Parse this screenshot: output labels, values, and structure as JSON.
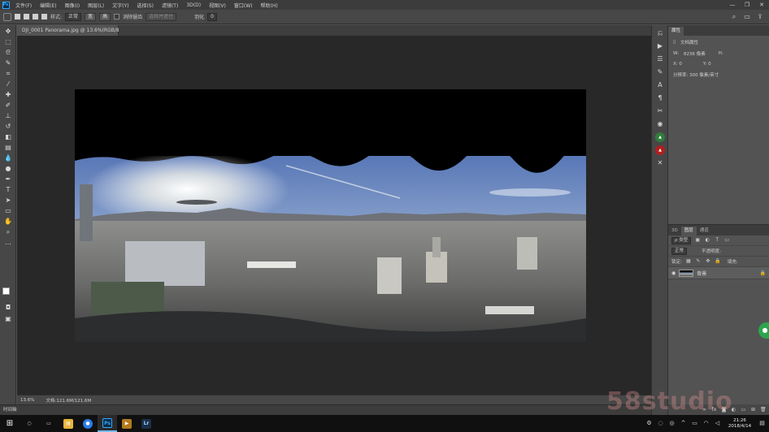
{
  "menubar": {
    "logo": "Ps",
    "items": [
      "文件(F)",
      "编辑(E)",
      "图像(I)",
      "图层(L)",
      "文字(Y)",
      "选择(S)",
      "滤镜(T)",
      "3D(D)",
      "视图(V)",
      "窗口(W)",
      "帮助(H)"
    ],
    "window_controls": [
      "—",
      "❐",
      "✕"
    ]
  },
  "options": {
    "style_label": "样式:",
    "style_value": "正常",
    "width_label": "宽",
    "height_label": "高",
    "feather_label": "羽化",
    "feather_value": "0",
    "antialias_label": "消除锯齿",
    "select_mask_label": "选择并遮住"
  },
  "document": {
    "tab_title": "DJI_0001 Panorama.jpg @ 13.6%(RGB/8)",
    "close": "×",
    "zoom": "13.6%",
    "doc_size": "文档:121.6M/121.6M"
  },
  "timeline": {
    "label": "时间轴"
  },
  "properties": {
    "tabs": [
      "属性"
    ],
    "layer_kind": "文档属性",
    "w_label": "W:",
    "w_value": "8236 像素",
    "h_label": "H:",
    "x_label": "X: 0",
    "y_label": "Y: 0",
    "resolution": "分辨率: 300 像素/英寸"
  },
  "layers": {
    "tabs": [
      "3D",
      "图层",
      "通道"
    ],
    "kind_label": "ρ 类型",
    "blend_mode": "正常",
    "opacity_label": "不透明度:",
    "lock_label": "锁定:",
    "fill_label": "填充:",
    "layer_name": "背景"
  },
  "taskbar": {
    "start": "⊞",
    "clock_time": "21:26",
    "clock_date": "2018/4/14",
    "apps": [
      {
        "name": "search",
        "label": "○",
        "color": "#101010"
      },
      {
        "name": "task-view",
        "label": "▭",
        "color": "#101010"
      },
      {
        "name": "file-explorer",
        "label": "▤",
        "color": "#e8b53a"
      },
      {
        "name": "chrome",
        "label": "●",
        "color": "#2b7de9"
      },
      {
        "name": "photoshop",
        "label": "Ps",
        "color": "#0c2c46"
      },
      {
        "name": "media",
        "label": "▶",
        "color": "#b47a1c"
      },
      {
        "name": "app-lr",
        "label": "Lr",
        "color": "#1c2f4a"
      }
    ]
  },
  "watermark": "58studio",
  "colors": {
    "accent": "#31a8ff",
    "canvas_bg": "#282828",
    "panel_bg": "#535353"
  }
}
